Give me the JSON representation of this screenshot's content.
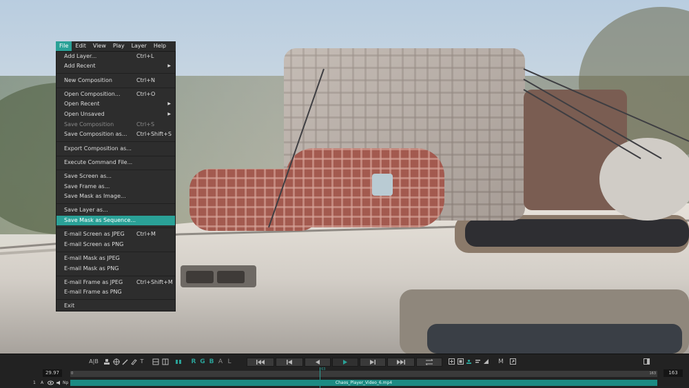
{
  "menubar": {
    "items": [
      {
        "label": "File",
        "active": true
      },
      {
        "label": "Edit"
      },
      {
        "label": "View"
      },
      {
        "label": "Play"
      },
      {
        "label": "Layer"
      },
      {
        "label": "Help"
      }
    ]
  },
  "file_menu": {
    "items": [
      {
        "label": "Add Layer...",
        "shortcut": "Ctrl+L"
      },
      {
        "label": "Add Recent",
        "submenu": true
      },
      {
        "label": "New Composition",
        "shortcut": "Ctrl+N"
      },
      {
        "label": "Open Composition...",
        "shortcut": "Ctrl+O"
      },
      {
        "label": "Open Recent",
        "submenu": true
      },
      {
        "label": "Open Unsaved",
        "submenu": true
      },
      {
        "label": "Save Composition",
        "shortcut": "Ctrl+S",
        "disabled": true
      },
      {
        "label": "Save Composition as...",
        "shortcut": "Ctrl+Shift+S"
      },
      {
        "label": "Export Composition as..."
      },
      {
        "label": "Execute Command File..."
      },
      {
        "label": "Save Screen as..."
      },
      {
        "label": "Save Frame as..."
      },
      {
        "label": "Save Mask as Image..."
      },
      {
        "label": "Save Layer as..."
      },
      {
        "label": "Save Mask as Sequence...",
        "highlighted": true
      },
      {
        "label": "E-mail Screen as JPEG",
        "shortcut": "Ctrl+M"
      },
      {
        "label": "E-mail Screen as PNG"
      },
      {
        "label": "E-mail Mask as JPEG"
      },
      {
        "label": "E-mail Mask as PNG"
      },
      {
        "label": "E-mail Frame as JPEG",
        "shortcut": "Ctrl+Shift+M"
      },
      {
        "label": "E-mail Frame as PNG"
      },
      {
        "label": "Exit"
      }
    ]
  },
  "toolbar": {
    "ab_label": "A|B",
    "text_tool": "T",
    "channels": [
      {
        "label": "R",
        "active": true
      },
      {
        "label": "G",
        "active": true
      },
      {
        "label": "B",
        "active": true
      },
      {
        "label": "A",
        "active": false
      },
      {
        "label": "L",
        "active": false
      }
    ],
    "marker_label": "M",
    "icons": [
      "compare-icon",
      "stamp-icon",
      "crosshair-icon",
      "pen-icon",
      "ruler-icon",
      "layout-icon",
      "grid-icon",
      "split-icon",
      "first-frame-icon",
      "prev-frame-icon",
      "play-reverse-icon",
      "play-icon",
      "next-frame-icon",
      "last-frame-icon",
      "loop-icon",
      "zoom-icon",
      "color-icon",
      "lut-icon",
      "histogram-icon",
      "volume-icon",
      "export-icon",
      "panel-icon"
    ]
  },
  "timeline": {
    "fps": "29.97",
    "start_frame": "0",
    "current_frame": "63",
    "end_label": "163",
    "end_frame": "163",
    "layer_number": "1",
    "layer_flag": "A",
    "layer_np": "Np",
    "clip_name": "Chaos_Player_Video_6.mp4",
    "playhead_fraction": 0.425
  },
  "colors": {
    "accent": "#2aa197",
    "menu_bg": "#2d2d2d",
    "clip": "#1c8b83"
  }
}
